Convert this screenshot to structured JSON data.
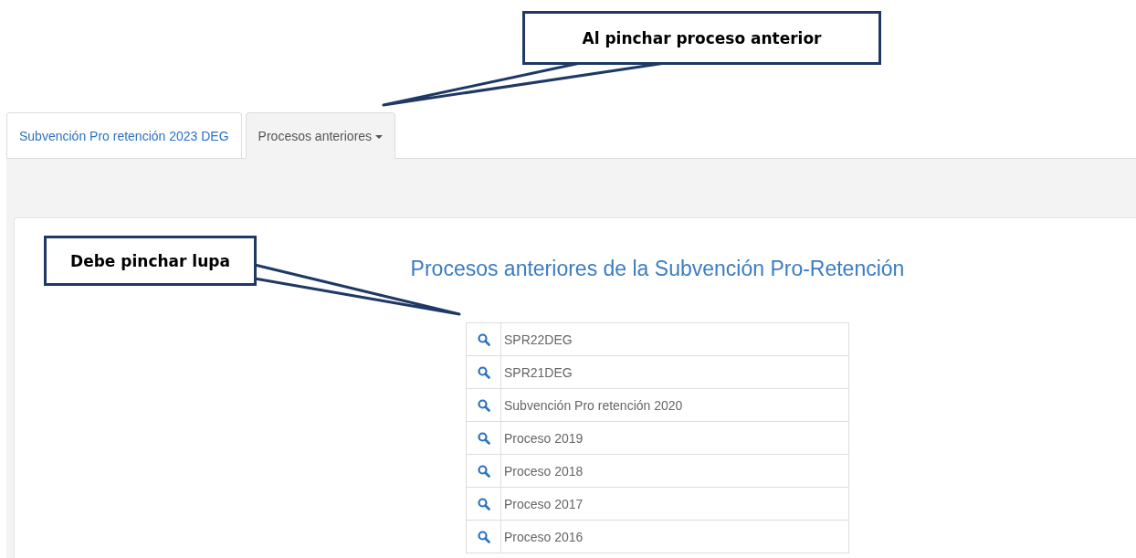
{
  "tabs": [
    {
      "label": "Subvención Pro retención 2023 DEG",
      "selected": false,
      "dropdown": false
    },
    {
      "label": "Procesos anteriores",
      "selected": true,
      "dropdown": true
    }
  ],
  "panel": {
    "title": "Procesos anteriores de la Subvención Pro-Retención",
    "rows": [
      {
        "label": "SPR22DEG"
      },
      {
        "label": "SPR21DEG"
      },
      {
        "label": "Subvención Pro retención 2020"
      },
      {
        "label": "Proceso 2019"
      },
      {
        "label": "Proceso 2018"
      },
      {
        "label": "Proceso 2017"
      },
      {
        "label": "Proceso 2016"
      }
    ]
  },
  "callouts": [
    {
      "text": "Al pinchar proceso anterior"
    },
    {
      "text": "Debe pinchar lupa"
    }
  ]
}
